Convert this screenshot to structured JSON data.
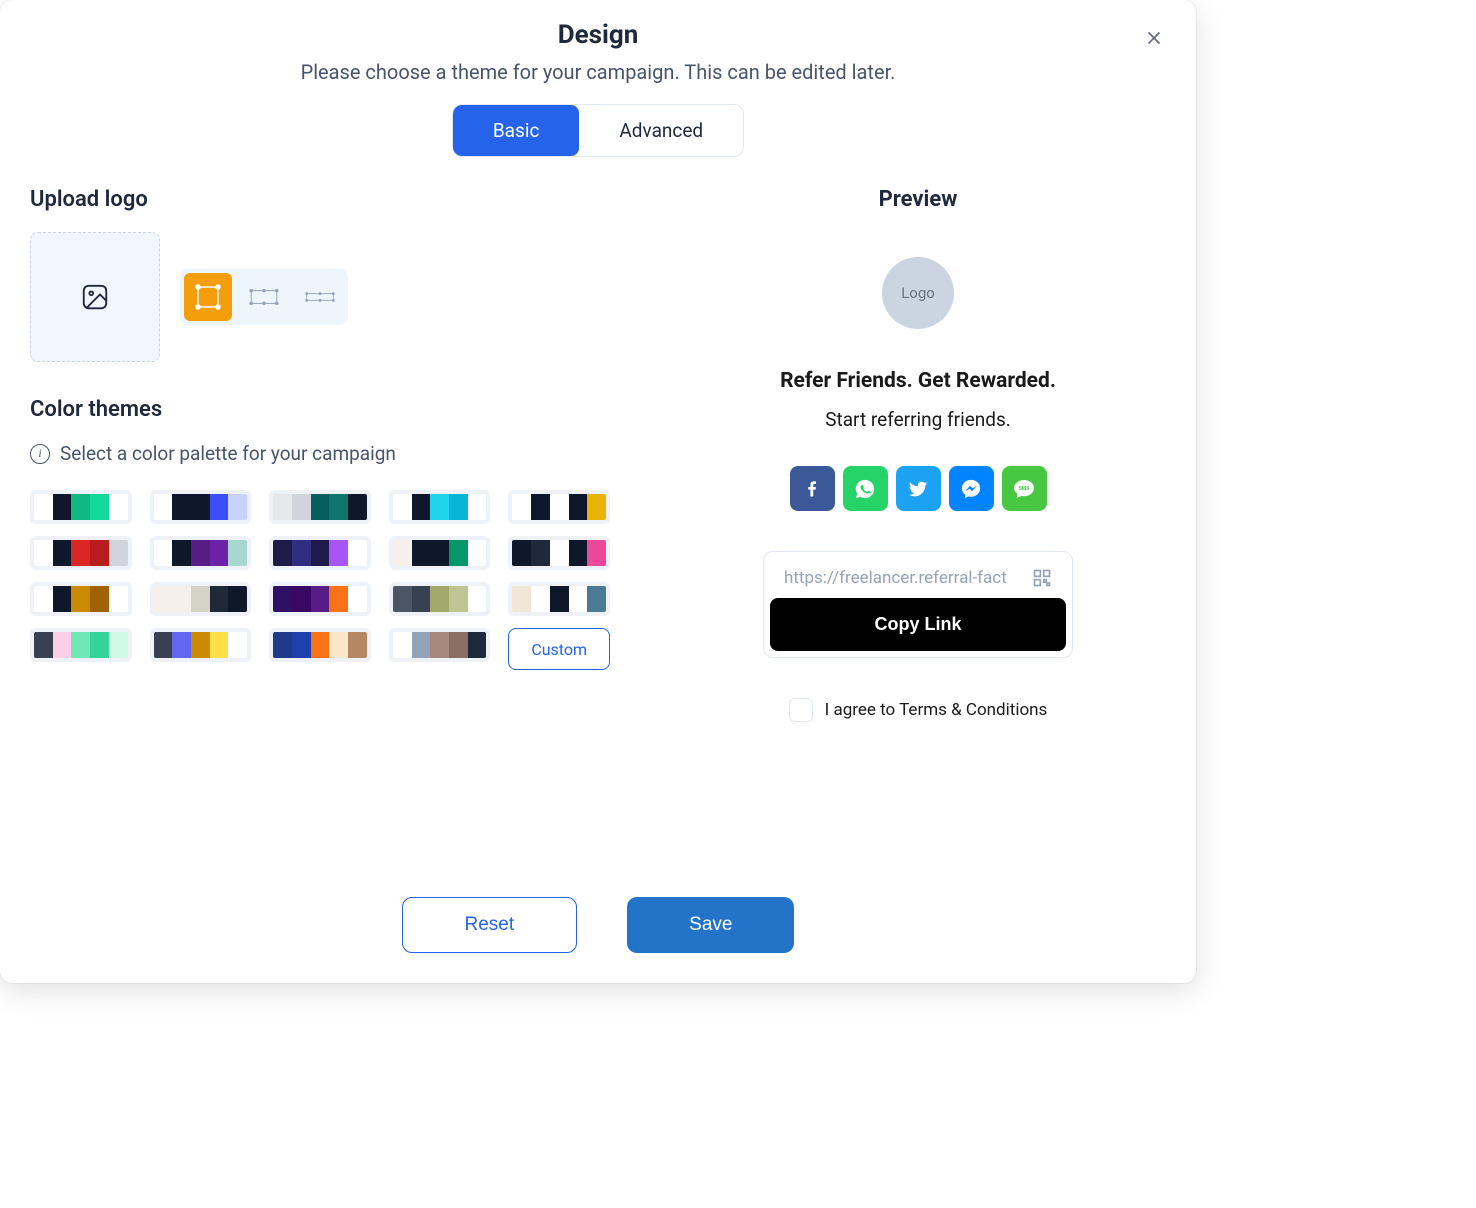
{
  "modal": {
    "title": "Design",
    "subtitle": "Please choose a theme for your campaign. This can be edited later.",
    "tabs": {
      "basic": "Basic",
      "advanced": "Advanced"
    }
  },
  "upload": {
    "title": "Upload logo"
  },
  "color_themes": {
    "title": "Color themes",
    "info": "Select a color palette for your campaign",
    "custom": "Custom",
    "palettes": [
      [
        "#ffffff",
        "#0f172a",
        "#10b981",
        "#10d99a",
        "#ffffff"
      ],
      [
        "#ffffff",
        "#0f172a",
        "#0f172a",
        "#3b4ff5",
        "#c7d2fe"
      ],
      [
        "#e5e7eb",
        "#d1d5db",
        "#065f5b",
        "#0f766e",
        "#0f172a"
      ],
      [
        "#ffffff",
        "#0f172a",
        "#22d3ee",
        "#06b6d4",
        "#ffffff"
      ],
      [
        "#ffffff",
        "#0f172a",
        "#ffffff",
        "#0f172a",
        "#eab308"
      ],
      [
        "#ffffff",
        "#0f172a",
        "#dc2626",
        "#b91c1c",
        "#d1d5db"
      ],
      [
        "#ffffff",
        "#0f172a",
        "#581c87",
        "#6b21a8",
        "#a7d7cf"
      ],
      [
        "#1e1b4b",
        "#312e81",
        "#1e1b4b",
        "#a855f7",
        "#ffffff"
      ],
      [
        "#f5f1ea",
        "#0f172a",
        "#0f172a",
        "#059669",
        "#ffffff"
      ],
      [
        "#0f172a",
        "#1e293b",
        "#ffffff",
        "#0f172a",
        "#ec4899"
      ],
      [
        "#ffffff",
        "#0f172a",
        "#ca8a04",
        "#a16207",
        "#ffffff"
      ],
      [
        "#f5f1ea",
        "#f5f1ea",
        "#d6d3c8",
        "#1f2937",
        "#0f172a"
      ],
      [
        "#2e1065",
        "#3b0764",
        "#581c87",
        "#f97316",
        "#ffffff"
      ],
      [
        "#4b5563",
        "#374151",
        "#a3a86d",
        "#bfc493",
        "#ffffff"
      ],
      [
        "#f0e6d6",
        "#ffffff",
        "#0f172a",
        "#ffffff",
        "#4a7a94"
      ],
      [
        "#374151",
        "#fbcfe8",
        "#6ee7b7",
        "#34d399",
        "#d1fae5"
      ],
      [
        "#374151",
        "#6366f1",
        "#ca8a04",
        "#fde047",
        "#ffffff"
      ],
      [
        "#1e3a8a",
        "#1e40af",
        "#f97316",
        "#fde6c8",
        "#b58863"
      ],
      [
        "#ffffff",
        "#94a3b8",
        "#a8877d",
        "#8b6f66",
        "#1e293b"
      ]
    ]
  },
  "preview": {
    "title": "Preview",
    "logo_placeholder": "Logo",
    "heading": "Refer Friends. Get Rewarded.",
    "subheading": "Start referring friends.",
    "link": "https://freelancer.referral-fact",
    "copy_button": "Copy Link",
    "terms": "I agree to Terms & Conditions"
  },
  "footer": {
    "reset": "Reset",
    "save": "Save"
  }
}
